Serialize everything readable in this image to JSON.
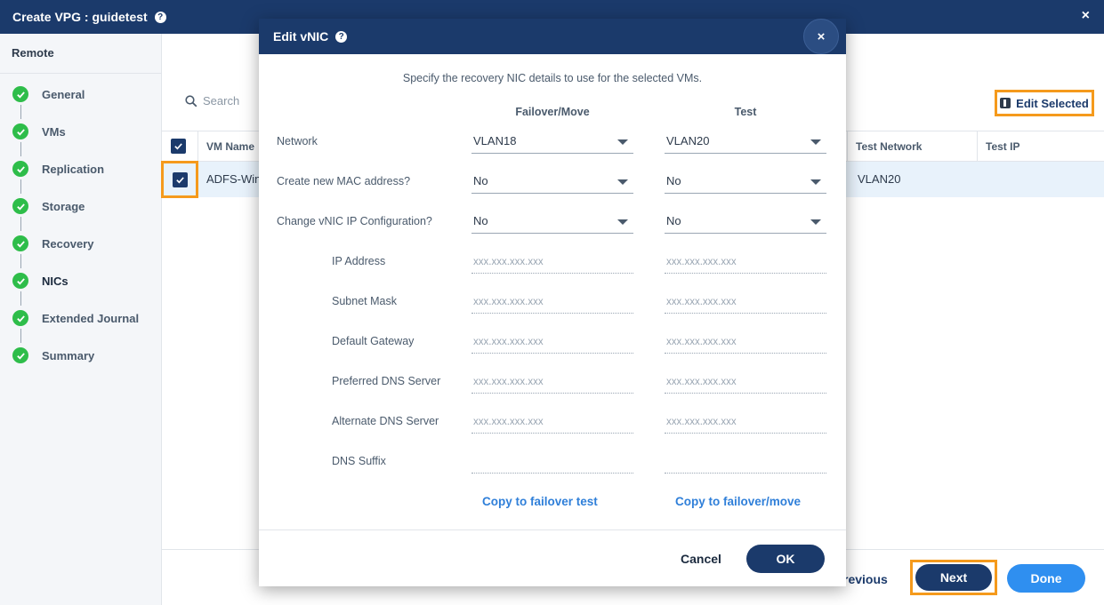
{
  "window": {
    "title": "Create VPG : guidetest",
    "help_icon": "?",
    "close_icon": "×"
  },
  "sidebar": {
    "section": "Remote",
    "steps": [
      {
        "label": "General",
        "status": "complete"
      },
      {
        "label": "VMs",
        "status": "complete"
      },
      {
        "label": "Replication",
        "status": "complete"
      },
      {
        "label": "Storage",
        "status": "complete"
      },
      {
        "label": "Recovery",
        "status": "complete"
      },
      {
        "label": "NICs",
        "status": "current"
      },
      {
        "label": "Extended Journal",
        "status": "complete"
      },
      {
        "label": "Summary",
        "status": "complete"
      }
    ]
  },
  "main": {
    "search_placeholder": "Search",
    "edit_selected_label": "Edit Selected",
    "table": {
      "headers": {
        "vm_name": "VM Name",
        "test_network": "Test Network",
        "test_ip": "Test IP"
      },
      "rows": [
        {
          "vm_name": "ADFS-Win",
          "test_network": "VLAN20",
          "test_ip": ""
        }
      ]
    },
    "footer": {
      "previous_label": "revious",
      "next_label": "Next",
      "done_label": "Done"
    }
  },
  "modal": {
    "title": "Edit vNIC",
    "help_icon": "?",
    "close_icon": "×",
    "description": "Specify the recovery NIC details to use for the selected VMs.",
    "columns": {
      "failover": "Failover/Move",
      "test": "Test"
    },
    "selects": [
      {
        "label": "Network",
        "failover": "VLAN18",
        "test": "VLAN20"
      },
      {
        "label": "Create new MAC address?",
        "failover": "No",
        "test": "No"
      },
      {
        "label": "Change vNIC IP Configuration?",
        "failover": "No",
        "test": "No"
      }
    ],
    "ip_fields": [
      {
        "label": "IP Address",
        "placeholder": "xxx.xxx.xxx.xxx"
      },
      {
        "label": "Subnet Mask",
        "placeholder": "xxx.xxx.xxx.xxx"
      },
      {
        "label": "Default Gateway",
        "placeholder": "xxx.xxx.xxx.xxx"
      },
      {
        "label": "Preferred DNS Server",
        "placeholder": "xxx.xxx.xxx.xxx"
      },
      {
        "label": "Alternate DNS Server",
        "placeholder": "xxx.xxx.xxx.xxx"
      },
      {
        "label": "DNS Suffix",
        "placeholder": ""
      }
    ],
    "copy_to_test_label": "Copy to failover test",
    "copy_to_failover_label": "Copy to failover/move",
    "cancel_label": "Cancel",
    "ok_label": "OK"
  },
  "colors": {
    "navy": "#1b3a6b",
    "accent_blue": "#2f8ff0",
    "highlight_orange": "#f59a1c",
    "success_green": "#2ebd4a"
  }
}
